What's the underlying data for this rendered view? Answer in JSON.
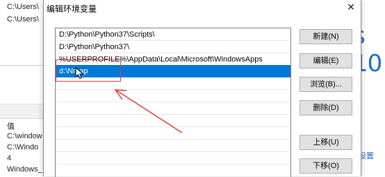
{
  "background": {
    "lines": [
      "C:\\Users\\",
      "C:\\Users\\",
      "值",
      "C:\\window",
      "C:\\Windo",
      "4",
      "Windows_"
    ],
    "right_text": "s 10",
    "right_link": "设置"
  },
  "dialog": {
    "title": "编辑环境变量",
    "close_glyph": "✕",
    "entries": [
      "D:\\Python\\Python37\\Scripts\\",
      "D:\\Python\\Python37\\",
      "%USERPROFILE%\\AppData\\Local\\Microsoft\\WindowsApps",
      "d:\\Nmap"
    ],
    "selected_index": 3,
    "buttons": {
      "new": "新建(N)",
      "edit": "编辑(E)",
      "browse": "浏览(B)...",
      "delete": "删除(D)",
      "move_up": "上移(U)",
      "move_down": "下移(O)"
    }
  },
  "annotation": {
    "color": "#e53935"
  },
  "colors": {
    "selection": "#0078d7",
    "accent_text": "#1e6fc7"
  }
}
